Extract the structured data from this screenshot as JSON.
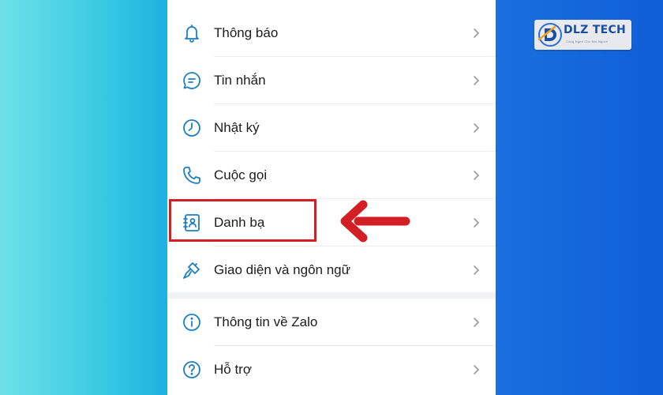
{
  "settings": {
    "items": [
      {
        "label": "Thông báo",
        "icon": "bell-icon"
      },
      {
        "label": "Tin nhắn",
        "icon": "chat-bubble-icon"
      },
      {
        "label": "Nhật ký",
        "icon": "clock-icon"
      },
      {
        "label": "Cuộc gọi",
        "icon": "phone-icon"
      },
      {
        "label": "Danh bạ",
        "icon": "contacts-book-icon"
      },
      {
        "label": "Giao diện và ngôn ngữ",
        "icon": "paintbrush-icon"
      }
    ],
    "items_2": [
      {
        "label": "Thông tin về Zalo",
        "icon": "info-icon"
      },
      {
        "label": "Hỗ trợ",
        "icon": "help-icon"
      }
    ]
  },
  "annotation": {
    "highlight_color": "#d21f26",
    "highlighted_item": "Danh bạ"
  },
  "logo": {
    "brand": "DLZ TECH",
    "tagline": "Công Nghệ Cho Mọi Người"
  },
  "colors": {
    "icon": "#1c7fc2",
    "text": "#1c1c1c",
    "chevron": "#9a9a9a"
  }
}
